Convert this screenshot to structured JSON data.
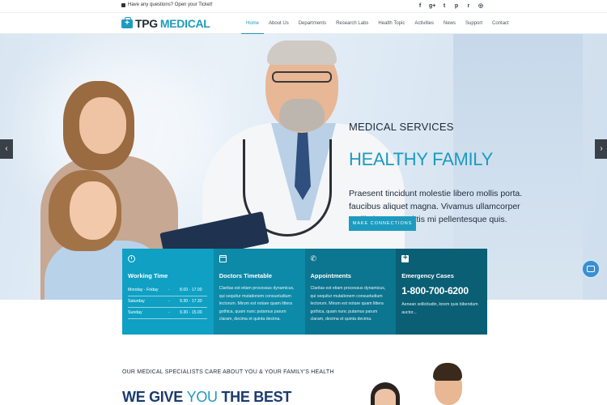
{
  "topbar": {
    "ticket_text": "Have any questions? Open your Ticket!",
    "socials": [
      {
        "icon": "facebook-icon",
        "glyph": "f"
      },
      {
        "icon": "google-plus-icon",
        "glyph": "g+"
      },
      {
        "icon": "twitter-icon",
        "glyph": "t"
      },
      {
        "icon": "pinterest-icon",
        "glyph": "p"
      },
      {
        "icon": "rss-icon",
        "glyph": "r"
      },
      {
        "icon": "dribbble-icon",
        "glyph": "◎"
      }
    ]
  },
  "logo": {
    "part1": "TPG",
    "part2": "MEDICAL"
  },
  "nav": {
    "items": [
      "Home",
      "About Us",
      "Departments",
      "Research Labs",
      "Health Topic",
      "Activities",
      "News",
      "Support",
      "Contact"
    ],
    "active": "Home"
  },
  "hero": {
    "kicker": "MEDICAL SERVICES",
    "headline": "HEALTHY FAMILY",
    "description": "Praesent tincidunt molestie libero mollis porta. faucibus aliquet magna. Vivamus ullamcorper mollis leo, at sagittis mi pellentesque quis.",
    "cta": "MAKE CONNECTIONS",
    "prev_arrow": "‹",
    "next_arrow": "›"
  },
  "boxes": {
    "working_time": {
      "title": "Working Time",
      "rows": [
        {
          "day": "Monday - Friday",
          "dash": "-",
          "time": "8.00 - 17.00"
        },
        {
          "day": "Saturday",
          "dash": "-",
          "time": "9.30 - 17.30"
        },
        {
          "day": "Sunday",
          "dash": "-",
          "time": "9.30 - 15.00"
        }
      ]
    },
    "doctors_timetable": {
      "title": "Doctors Timetable",
      "text": "Claritas est etiam processus dynamicus, qui sequitur mutationem consuetudium lectorum. Mirum est notare quam littera gothica, quam nunc putamus parum claram, decima et quinta decima."
    },
    "appointments": {
      "title": "Appointments",
      "phone_glyph": "✆",
      "text": "Claritas est etiam processus dynamicus, qui sequitur mutationem consuetudium lectorum. Mirum est notare quam littera gothica, quam nunc putamus parum claram, decima et quinta decima."
    },
    "emergency": {
      "title": "Emergency Cases",
      "phone": "1-800-700-6200",
      "text": "Aenean sollicitudin, lorem quis bibendum auctor..."
    }
  },
  "lower": {
    "kicker": "OUR MEDICAL SPECIALISTS CARE ABOUT YOU & YOUR FAMILY'S HEALTH",
    "headline_w1": "WE GIVE",
    "headline_w2": "YOU",
    "headline_w3": "THE BEST"
  },
  "colors": {
    "accent": "#1d9bbf",
    "dark": "#1e2b3a",
    "navy": "#1a3b6e"
  }
}
